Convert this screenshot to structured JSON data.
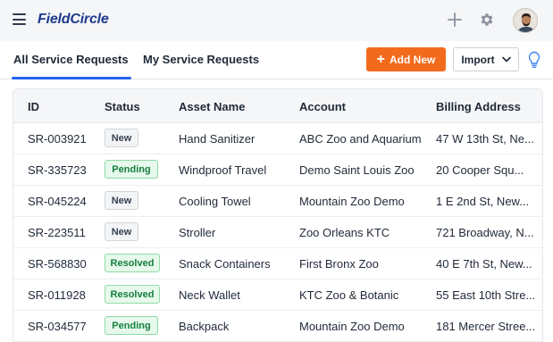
{
  "app": {
    "logo_text": "FieldCircle"
  },
  "tabs": [
    {
      "label": "All Service Requests",
      "active": true
    },
    {
      "label": "My Service Requests",
      "active": false
    }
  ],
  "actions": {
    "add_new_label": "Add New",
    "import_label": "Import"
  },
  "colors": {
    "accent_orange": "#f26b1d",
    "active_tab_underline": "#2563eb",
    "status_green": "#15803d"
  },
  "icons": {
    "menu": "hamburger-icon",
    "add": "plus-icon",
    "settings": "gear-icon",
    "help": "lightbulb-icon",
    "dropdown": "chevron-down-icon"
  },
  "table": {
    "columns": [
      "ID",
      "Status",
      "Asset Name",
      "Account",
      "Billing Address"
    ],
    "rows": [
      {
        "id": "SR-003921",
        "status": "New",
        "asset": "Hand Sanitizer",
        "account": "ABC Zoo and Aquarium",
        "address": "47 W 13th St, Ne..."
      },
      {
        "id": "SR-335723",
        "status": "Pending",
        "asset": "Windproof Travel",
        "account": "Demo Saint Louis Zoo",
        "address": "20 Cooper Squ..."
      },
      {
        "id": "SR-045224",
        "status": "New",
        "asset": "Cooling Towel",
        "account": "Mountain Zoo Demo",
        "address": "1 E 2nd St, New..."
      },
      {
        "id": "SR-223511",
        "status": "New",
        "asset": "Stroller",
        "account": "Zoo Orleans KTC",
        "address": "721 Broadway, N..."
      },
      {
        "id": "SR-568830",
        "status": "Resolved",
        "asset": "Snack Containers",
        "account": "First Bronx Zoo",
        "address": "40 E 7th St, New..."
      },
      {
        "id": "SR-011928",
        "status": "Resolved",
        "asset": "Neck Wallet",
        "account": "KTC Zoo & Botanic",
        "address": "55 East 10th Stre..."
      },
      {
        "id": "SR-034577",
        "status": "Pending",
        "asset": "Backpack",
        "account": "Mountain Zoo Demo",
        "address": "181 Mercer Stree..."
      }
    ]
  }
}
